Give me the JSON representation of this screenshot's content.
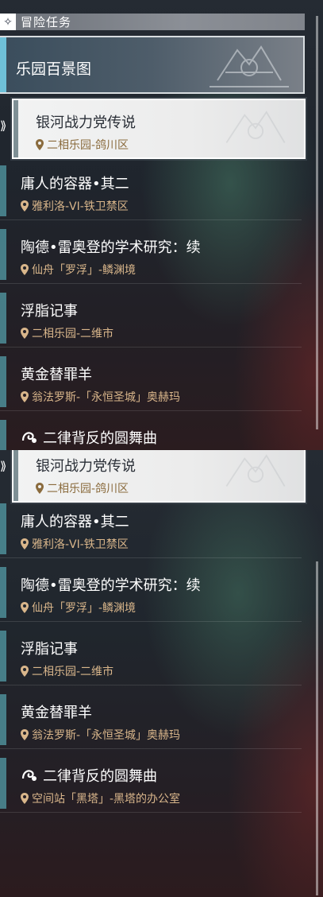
{
  "section": {
    "title": "冒险任务",
    "icon": "diamond-sparkle-icon"
  },
  "featured": {
    "title": "乐园百景图"
  },
  "selected_quest": {
    "title": "银河战力党传说",
    "location": "二相乐园-鸽川区"
  },
  "quests": [
    {
      "title": "庸人的容器•其二",
      "location": "雅利洛-VI-铁卫禁区"
    },
    {
      "title": "陶德•雷奥登的学术研究：续",
      "location": "仙舟「罗浮」-鳞渊境"
    },
    {
      "title": "浮脂记事",
      "location": "二相乐园-二维市"
    },
    {
      "title": "黄金替罪羊",
      "location": "翁法罗斯-「永恒圣城」奥赫玛"
    },
    {
      "title": "二律背反的圆舞曲",
      "location": "空间站「黑塔」-黑塔的办公室",
      "icon": "special-quest-icon"
    }
  ],
  "colors": {
    "accent": "#6ec0d8",
    "location_text": "#d9b68b",
    "tab": "#4e8e99"
  }
}
